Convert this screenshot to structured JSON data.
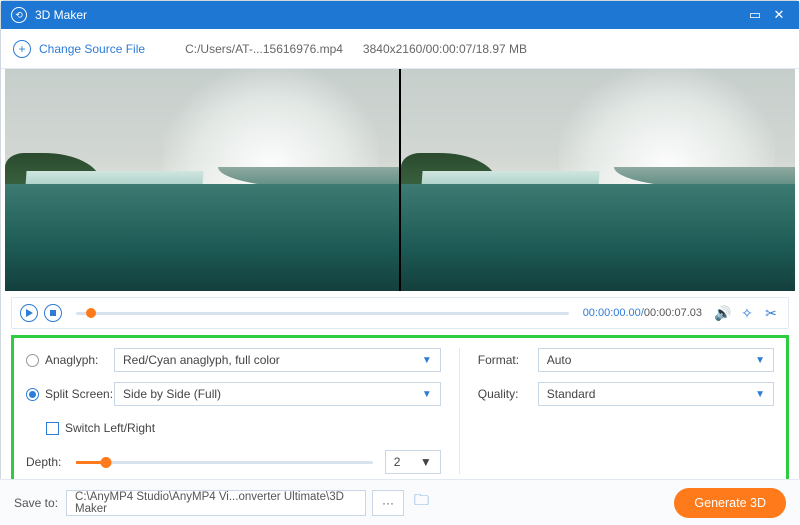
{
  "titlebar": {
    "title": "3D Maker"
  },
  "toolbar": {
    "change_source": "Change Source File",
    "filepath": "C:/Users/AT-...15616976.mp4",
    "fileinfo": "3840x2160/00:00:07/18.97 MB"
  },
  "controls": {
    "current": "00:00:00.00",
    "duration": "00:00:07.03"
  },
  "settings": {
    "anaglyph_label": "Anaglyph:",
    "anaglyph_value": "Red/Cyan anaglyph, full color",
    "split_label": "Split Screen:",
    "split_value": "Side by Side (Full)",
    "switch_label": "Switch Left/Right",
    "depth_label": "Depth:",
    "depth_value": "2",
    "format_label": "Format:",
    "format_value": "Auto",
    "quality_label": "Quality:",
    "quality_value": "Standard",
    "mode_selected": "split"
  },
  "bottom": {
    "saveto_label": "Save to:",
    "path": "C:\\AnyMP4 Studio\\AnyMP4 Vi...onverter Ultimate\\3D Maker",
    "generate": "Generate 3D"
  }
}
